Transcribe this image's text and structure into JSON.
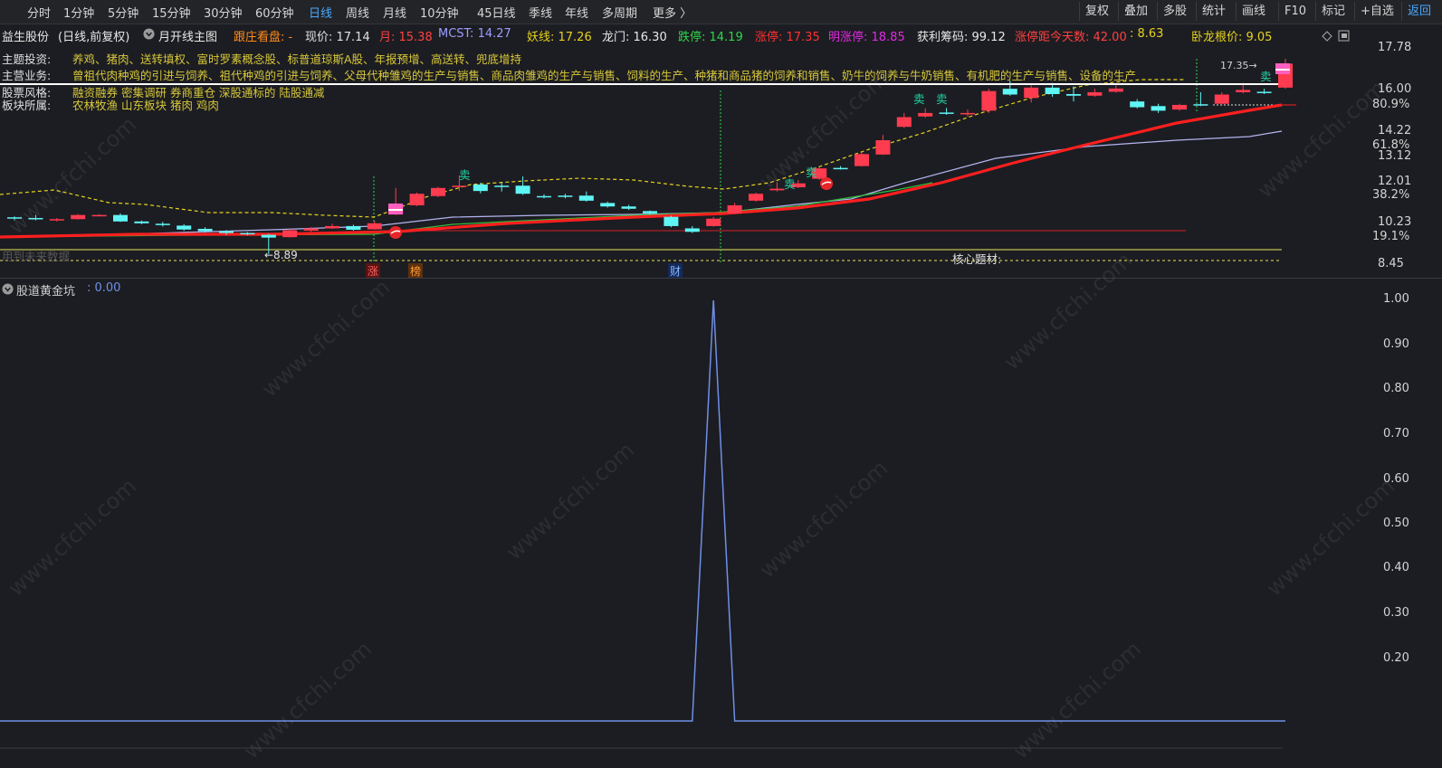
{
  "toolbar": {
    "timeframes": [
      "分时",
      "1分钟",
      "5分钟",
      "15分钟",
      "30分钟",
      "60分钟",
      "日线",
      "周线",
      "月线",
      "10分钟",
      "45日线",
      "季线",
      "年线",
      "多周期",
      "更多 〉"
    ],
    "active_timeframe": "日线",
    "right_buttons": [
      "复权",
      "叠加",
      "多股",
      "统计",
      "画线",
      "F10",
      "标记",
      "+自选",
      "返回"
    ]
  },
  "infobar": {
    "stock_name": "益生股份",
    "mode": "(日线,前复权)",
    "main_indicator": "月开线主图",
    "follow_label": "跟庄看盘: -",
    "price_label": "现价: 17.14",
    "month_label": "月: 15.38",
    "mcst_label": "MCST: 14.27",
    "yaoxian_label": "妖线: 17.26",
    "longmen_label": "龙门: 16.30",
    "dieting_label": "跌停: 14.19",
    "zhangting_label": "涨停: 17.35",
    "ming_label": "明涨停: 18.85",
    "profit_label": "获利筹码: 99.12",
    "days_label": "涨停距今天数: 42.00",
    "days_value": ": 8.63",
    "wolong_label": "卧龙根价: 9.05"
  },
  "overlay": {
    "theme_label": "主题投资:",
    "theme_text": "养鸡、猪肉、送转填权、富时罗素概念股、标普道琼斯A股、年报预增、高送转、兜底增持",
    "business_label": "主营业务:",
    "business_text": "曾祖代肉种鸡的引进与饲养、祖代种鸡的引进与饲养、父母代种雏鸡的生产与销售、商品肉雏鸡的生产与销售、饲料的生产、种猪和商品猪的饲养和销售、奶牛的饲养与牛奶销售、有机肥的生产与销售、设备的生产",
    "style_label": "股票风格:",
    "style_text": "融资融券 密集调研 券商重仓 深股通标的 陆股通减",
    "sector_label": "板块所属:",
    "sector_text": "农林牧渔 山东板块 猪肉 鸡肉",
    "low_price": "←8.89",
    "core_label": "核心题材:",
    "future_label": "用到未来数据",
    "high_price": "17.35→",
    "mark_zhang": "涨",
    "mark_bang": "榜",
    "mark_cai": "财",
    "sell": "卖"
  },
  "price_axis": [
    "17.78",
    "16.00",
    "80.9%",
    "14.22",
    "61.8%",
    "13.12",
    "12.01",
    "38.2%",
    "10.23",
    "19.1%",
    "8.45"
  ],
  "sub_chart": {
    "title": "股道黄金坑",
    "value": ": 0.00",
    "axis": [
      "1.00",
      "0.90",
      "0.80",
      "0.70",
      "0.60",
      "0.50",
      "0.40",
      "0.30",
      "0.20"
    ]
  },
  "watermark": "www.cfchi.com",
  "colors": {
    "up": "#ff3b4f",
    "down": "#5ff5f5",
    "ma_red": "#ff1f1f",
    "ma_lav": "#b4b4f0",
    "yaoxian": "#e6d21e",
    "sub_line": "#6f8fe8"
  },
  "chart_data": {
    "type": "candlestick",
    "candles": [
      [
        10.48,
        10.45,
        10.52,
        10.35
      ],
      [
        10.45,
        10.4,
        10.58,
        10.35
      ],
      [
        10.38,
        10.4,
        10.45,
        10.3
      ],
      [
        10.4,
        10.58,
        10.62,
        10.38
      ],
      [
        10.58,
        10.58,
        10.62,
        10.52
      ],
      [
        10.58,
        10.3,
        10.65,
        10.28
      ],
      [
        10.3,
        10.22,
        10.34,
        10.18
      ],
      [
        10.2,
        10.15,
        10.28,
        10.08
      ],
      [
        10.12,
        9.95,
        10.18,
        9.9
      ],
      [
        9.98,
        9.88,
        10.05,
        9.82
      ],
      [
        9.88,
        9.8,
        9.92,
        9.72
      ],
      [
        9.8,
        9.76,
        9.84,
        9.7
      ],
      [
        9.72,
        9.6,
        9.76,
        8.89
      ],
      [
        9.62,
        9.92,
        9.98,
        9.6
      ],
      [
        9.9,
        10.0,
        10.05,
        9.85
      ],
      [
        10.0,
        10.1,
        10.2,
        9.98
      ],
      [
        10.1,
        9.94,
        10.16,
        9.9
      ],
      [
        9.96,
        10.22,
        10.32,
        9.94
      ],
      [
        10.6,
        11.07,
        11.75,
        10.58
      ],
      [
        11.0,
        11.5,
        11.55,
        10.96
      ],
      [
        11.4,
        11.75,
        11.8,
        11.35
      ],
      [
        11.82,
        11.85,
        12.3,
        11.62
      ],
      [
        11.9,
        11.62,
        11.98,
        11.52
      ],
      [
        11.85,
        11.8,
        12.0,
        11.6
      ],
      [
        11.85,
        11.5,
        12.25,
        11.45
      ],
      [
        11.4,
        11.36,
        11.48,
        11.3
      ],
      [
        11.42,
        11.38,
        11.5,
        11.3
      ],
      [
        11.42,
        11.2,
        11.6,
        11.16
      ],
      [
        11.1,
        10.95,
        11.16,
        10.9
      ],
      [
        10.95,
        10.85,
        11.02,
        10.8
      ],
      [
        10.75,
        10.65,
        10.78,
        10.6
      ],
      [
        10.5,
        10.1,
        10.55,
        10.05
      ],
      [
        10.0,
        9.85,
        10.1,
        9.8
      ],
      [
        10.1,
        10.42,
        10.5,
        10.08
      ],
      [
        10.65,
        11.0,
        11.1,
        10.62
      ],
      [
        11.2,
        11.5,
        11.55,
        11.15
      ],
      [
        11.65,
        11.72,
        12.0,
        11.6
      ],
      [
        11.78,
        11.95,
        12.1,
        11.75
      ],
      [
        12.15,
        12.6,
        12.65,
        12.1
      ],
      [
        12.62,
        12.6,
        12.7,
        12.55
      ],
      [
        12.7,
        13.22,
        13.3,
        12.68
      ],
      [
        13.2,
        13.82,
        14.05,
        13.18
      ],
      [
        14.4,
        14.82,
        15.0,
        14.35
      ],
      [
        14.85,
        15.0,
        15.2,
        14.8
      ],
      [
        15.02,
        14.98,
        15.22,
        14.92
      ],
      [
        14.98,
        15.0,
        15.15,
        14.85
      ],
      [
        15.1,
        15.95,
        16.05,
        15.0
      ],
      [
        16.05,
        15.8,
        16.4,
        15.75
      ],
      [
        15.65,
        16.1,
        16.2,
        15.45
      ],
      [
        16.1,
        15.82,
        16.3,
        15.7
      ],
      [
        15.82,
        15.75,
        16.15,
        15.5
      ],
      [
        15.75,
        15.9,
        16.05,
        15.7
      ],
      [
        15.92,
        16.06,
        16.2,
        15.88
      ],
      [
        15.5,
        15.25,
        15.6,
        15.2
      ],
      [
        15.3,
        15.1,
        15.4,
        15.0
      ],
      [
        15.15,
        15.35,
        15.4,
        15.1
      ],
      [
        15.38,
        15.35,
        15.9,
        15.3
      ],
      [
        15.4,
        15.8,
        15.9,
        15.35
      ],
      [
        15.9,
        16.0,
        16.3,
        15.85
      ],
      [
        15.92,
        15.88,
        16.05,
        15.82
      ],
      [
        16.1,
        17.14,
        17.35,
        16.05
      ]
    ]
  }
}
